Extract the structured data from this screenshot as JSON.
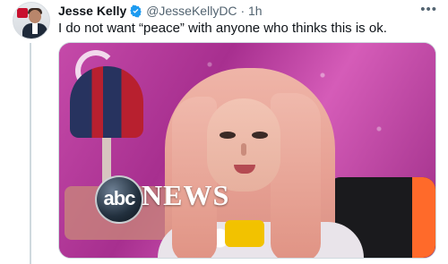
{
  "tweet": {
    "author_name": "Jesse Kelly",
    "handle": "@JesseKellyDC",
    "separator": "·",
    "time": "1h",
    "text": "I do not want “peace” with anyone who thinks this is ok.",
    "more_icon": "more-horizontal-icon",
    "verified_icon": "verified-badge-icon"
  },
  "media": {
    "watermark_logo": "abc",
    "watermark_text": "NEWS"
  },
  "colors": {
    "text_primary": "#0f1419",
    "text_secondary": "#536471",
    "verified_blue": "#1d9bf0",
    "thread_line": "#cfd9de"
  }
}
